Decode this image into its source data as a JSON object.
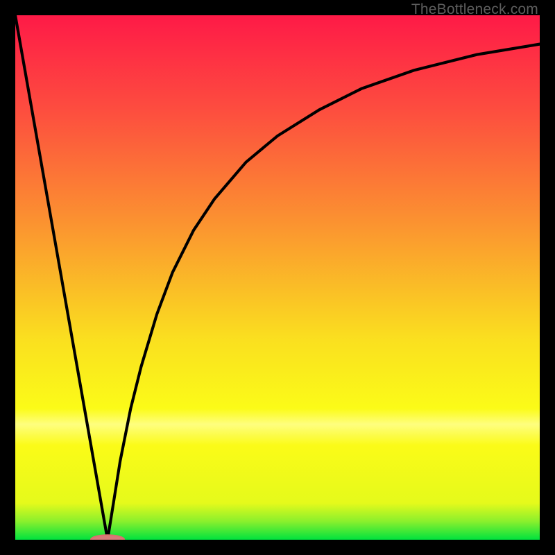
{
  "watermark": "TheBottleneck.com",
  "colors": {
    "frame": "#000000",
    "watermark": "#5d5d5d",
    "curve": "#000000",
    "marker_fill": "#d87a78",
    "marker_stroke": "#dd6f6c"
  },
  "gradient_stops": [
    {
      "pct": 0,
      "color": "#fe1a47"
    },
    {
      "pct": 18,
      "color": "#fd4d3f"
    },
    {
      "pct": 40,
      "color": "#fb9430"
    },
    {
      "pct": 62,
      "color": "#fae01f"
    },
    {
      "pct": 75,
      "color": "#fbfb18"
    },
    {
      "pct": 78,
      "color": "#fefe7f"
    },
    {
      "pct": 82,
      "color": "#fbfb18"
    },
    {
      "pct": 93,
      "color": "#e5fa1b"
    },
    {
      "pct": 96.5,
      "color": "#8af02d"
    },
    {
      "pct": 100,
      "color": "#00e23e"
    }
  ],
  "chart_data": {
    "type": "line",
    "title": "",
    "xlabel": "",
    "ylabel": "",
    "xlim": [
      0,
      100
    ],
    "ylim": [
      0,
      100
    ],
    "series": [
      {
        "name": "left-line",
        "x": [
          0,
          17.6
        ],
        "y": [
          100,
          0
        ]
      },
      {
        "name": "right-curve",
        "x": [
          17.6,
          20,
          22,
          24,
          27,
          30,
          34,
          38,
          44,
          50,
          58,
          66,
          76,
          88,
          100
        ],
        "y": [
          0,
          15,
          25,
          33,
          43,
          51,
          59,
          65,
          72,
          77,
          82,
          86,
          89.5,
          92.5,
          94.5
        ]
      }
    ],
    "marker": {
      "x": 17.6,
      "y": 0,
      "rx": 3.2,
      "ry": 0.9
    }
  }
}
